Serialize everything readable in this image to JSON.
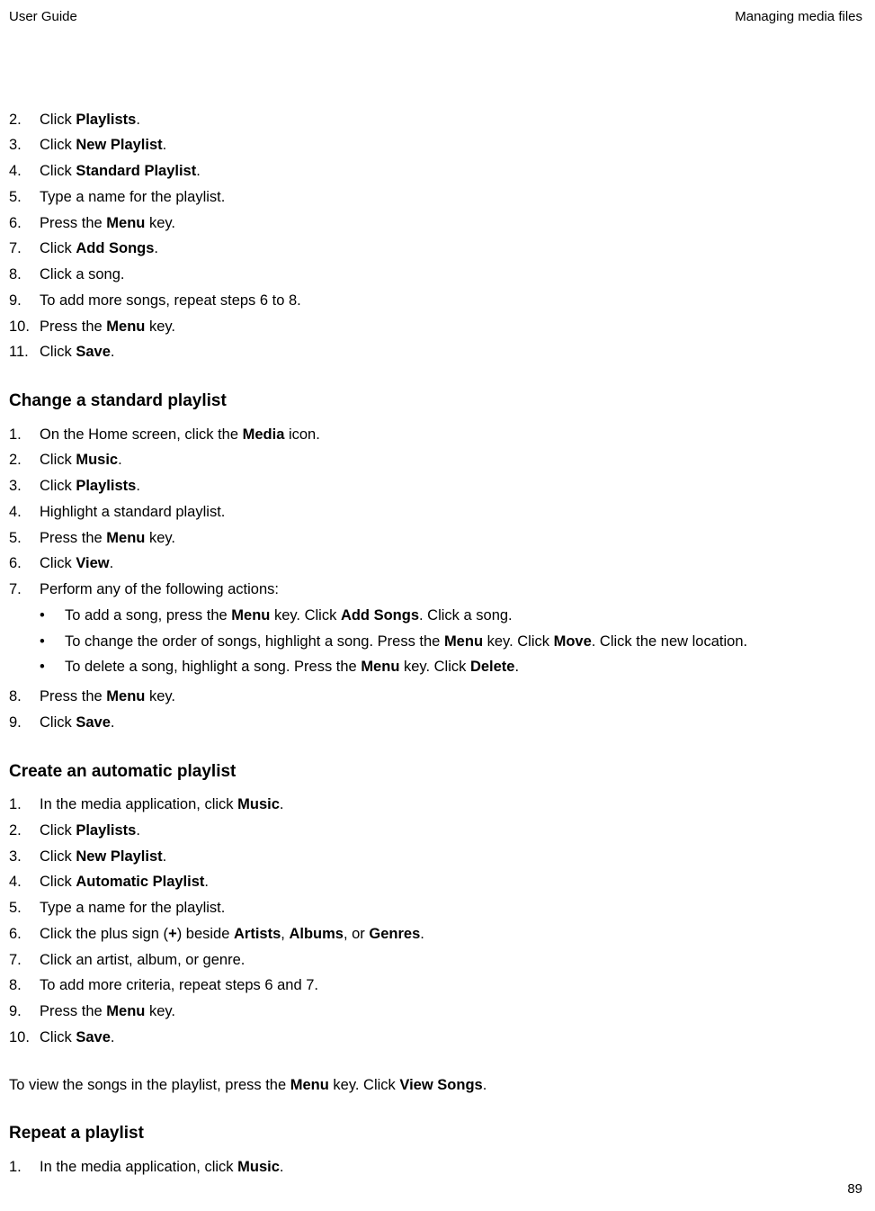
{
  "header": {
    "left": "User Guide",
    "right": "Managing media files"
  },
  "list1": [
    {
      "n": "2.",
      "parts": [
        "Click ",
        [
          "b",
          "Playlists"
        ],
        "."
      ]
    },
    {
      "n": "3.",
      "parts": [
        "Click ",
        [
          "b",
          "New Playlist"
        ],
        "."
      ]
    },
    {
      "n": "4.",
      "parts": [
        "Click ",
        [
          "b",
          "Standard Playlist"
        ],
        "."
      ]
    },
    {
      "n": "5.",
      "parts": [
        "Type a name for the playlist."
      ]
    },
    {
      "n": "6.",
      "parts": [
        "Press the ",
        [
          "b",
          "Menu"
        ],
        " key."
      ]
    },
    {
      "n": "7.",
      "parts": [
        "Click ",
        [
          "b",
          "Add Songs"
        ],
        "."
      ]
    },
    {
      "n": "8.",
      "parts": [
        "Click a song."
      ]
    },
    {
      "n": "9.",
      "parts": [
        "To add more songs, repeat steps 6 to 8."
      ]
    },
    {
      "n": "10.",
      "parts": [
        "Press the ",
        [
          "b",
          "Menu"
        ],
        " key."
      ]
    },
    {
      "n": "11.",
      "parts": [
        "Click ",
        [
          "b",
          "Save"
        ],
        "."
      ]
    }
  ],
  "section2": {
    "title": "Change a standard playlist",
    "items": [
      {
        "n": "1.",
        "parts": [
          "On the Home screen, click the ",
          [
            "b",
            "Media"
          ],
          " icon."
        ]
      },
      {
        "n": "2.",
        "parts": [
          "Click ",
          [
            "b",
            "Music"
          ],
          "."
        ]
      },
      {
        "n": "3.",
        "parts": [
          "Click ",
          [
            "b",
            "Playlists"
          ],
          "."
        ]
      },
      {
        "n": "4.",
        "parts": [
          "Highlight a standard playlist."
        ]
      },
      {
        "n": "5.",
        "parts": [
          "Press the ",
          [
            "b",
            "Menu"
          ],
          " key."
        ]
      },
      {
        "n": "6.",
        "parts": [
          "Click ",
          [
            "b",
            "View"
          ],
          "."
        ]
      },
      {
        "n": "7.",
        "parts": [
          "Perform any of the following actions:"
        ],
        "sub": [
          {
            "parts": [
              "To add a song, press the ",
              [
                "b",
                "Menu"
              ],
              " key. Click ",
              [
                "b",
                "Add Songs"
              ],
              ". Click a song."
            ]
          },
          {
            "parts": [
              "To change the order of songs, highlight a song. Press the ",
              [
                "b",
                "Menu"
              ],
              " key. Click ",
              [
                "b",
                "Move"
              ],
              ". Click the new location."
            ]
          },
          {
            "parts": [
              "To delete a song, highlight a song. Press the ",
              [
                "b",
                "Menu"
              ],
              " key. Click ",
              [
                "b",
                "Delete"
              ],
              "."
            ]
          }
        ]
      },
      {
        "n": "8.",
        "parts": [
          "Press the ",
          [
            "b",
            "Menu"
          ],
          " key."
        ]
      },
      {
        "n": "9.",
        "parts": [
          "Click ",
          [
            "b",
            "Save"
          ],
          "."
        ]
      }
    ]
  },
  "section3": {
    "title": "Create an automatic playlist",
    "items": [
      {
        "n": "1.",
        "parts": [
          "In the media application, click ",
          [
            "b",
            "Music"
          ],
          "."
        ]
      },
      {
        "n": "2.",
        "parts": [
          "Click ",
          [
            "b",
            "Playlists"
          ],
          "."
        ]
      },
      {
        "n": "3.",
        "parts": [
          "Click ",
          [
            "b",
            "New Playlist"
          ],
          "."
        ]
      },
      {
        "n": "4.",
        "parts": [
          "Click ",
          [
            "b",
            "Automatic Playlist"
          ],
          "."
        ]
      },
      {
        "n": "5.",
        "parts": [
          "Type a name for the playlist."
        ]
      },
      {
        "n": "6.",
        "parts": [
          "Click the plus sign (",
          [
            "b",
            "+"
          ],
          ") beside ",
          [
            "b",
            "Artists"
          ],
          ", ",
          [
            "b",
            "Albums"
          ],
          ", or ",
          [
            "b",
            "Genres"
          ],
          "."
        ]
      },
      {
        "n": "7.",
        "parts": [
          "Click an artist, album, or genre."
        ]
      },
      {
        "n": "8.",
        "parts": [
          "To add more criteria, repeat steps 6 and 7."
        ]
      },
      {
        "n": "9.",
        "parts": [
          "Press the ",
          [
            "b",
            "Menu"
          ],
          " key."
        ]
      },
      {
        "n": "10.",
        "parts": [
          "Click ",
          [
            "b",
            "Save"
          ],
          "."
        ]
      }
    ],
    "trailer": [
      "To view the songs in the playlist, press the ",
      [
        "b",
        "Menu"
      ],
      " key. Click ",
      [
        "b",
        "View Songs"
      ],
      "."
    ]
  },
  "section4": {
    "title": "Repeat a playlist",
    "items": [
      {
        "n": "1.",
        "parts": [
          "In the media application, click ",
          [
            "b",
            "Music"
          ],
          "."
        ]
      }
    ]
  },
  "pageNumber": "89"
}
